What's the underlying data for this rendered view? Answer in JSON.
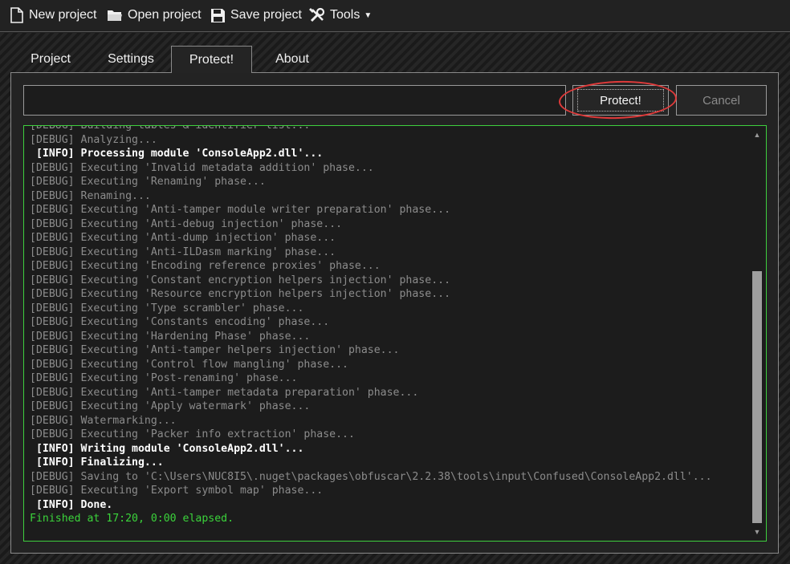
{
  "toolbar": {
    "new_project": "New project",
    "open_project": "Open project",
    "save_project": "Save project",
    "tools": "Tools"
  },
  "tabs": [
    "Project",
    "Settings",
    "Protect!",
    "About"
  ],
  "active_tab": "Protect!",
  "buttons": {
    "protect": "Protect!",
    "cancel": "Cancel"
  },
  "log": [
    {
      "level": "debug",
      "text": "[DEBUG] Building tables & identifier list..."
    },
    {
      "level": "debug",
      "text": "[DEBUG] Analyzing..."
    },
    {
      "level": "info",
      "text": " [INFO] Processing module 'ConsoleApp2.dll'..."
    },
    {
      "level": "debug",
      "text": "[DEBUG] Executing 'Invalid metadata addition' phase..."
    },
    {
      "level": "debug",
      "text": "[DEBUG] Executing 'Renaming' phase..."
    },
    {
      "level": "debug",
      "text": "[DEBUG] Renaming..."
    },
    {
      "level": "debug",
      "text": "[DEBUG] Executing 'Anti-tamper module writer preparation' phase..."
    },
    {
      "level": "debug",
      "text": "[DEBUG] Executing 'Anti-debug injection' phase..."
    },
    {
      "level": "debug",
      "text": "[DEBUG] Executing 'Anti-dump injection' phase..."
    },
    {
      "level": "debug",
      "text": "[DEBUG] Executing 'Anti-ILDasm marking' phase..."
    },
    {
      "level": "debug",
      "text": "[DEBUG] Executing 'Encoding reference proxies' phase..."
    },
    {
      "level": "debug",
      "text": "[DEBUG] Executing 'Constant encryption helpers injection' phase..."
    },
    {
      "level": "debug",
      "text": "[DEBUG] Executing 'Resource encryption helpers injection' phase..."
    },
    {
      "level": "debug",
      "text": "[DEBUG] Executing 'Type scrambler' phase..."
    },
    {
      "level": "debug",
      "text": "[DEBUG] Executing 'Constants encoding' phase..."
    },
    {
      "level": "debug",
      "text": "[DEBUG] Executing 'Hardening Phase' phase..."
    },
    {
      "level": "debug",
      "text": "[DEBUG] Executing 'Anti-tamper helpers injection' phase..."
    },
    {
      "level": "debug",
      "text": "[DEBUG] Executing 'Control flow mangling' phase..."
    },
    {
      "level": "debug",
      "text": "[DEBUG] Executing 'Post-renaming' phase..."
    },
    {
      "level": "debug",
      "text": "[DEBUG] Executing 'Anti-tamper metadata preparation' phase..."
    },
    {
      "level": "debug",
      "text": "[DEBUG] Executing 'Apply watermark' phase..."
    },
    {
      "level": "debug",
      "text": "[DEBUG] Watermarking..."
    },
    {
      "level": "debug",
      "text": "[DEBUG] Executing 'Packer info extraction' phase..."
    },
    {
      "level": "info",
      "text": " [INFO] Writing module 'ConsoleApp2.dll'..."
    },
    {
      "level": "info",
      "text": " [INFO] Finalizing..."
    },
    {
      "level": "debug",
      "text": "[DEBUG] Saving to 'C:\\Users\\NUC8I5\\.nuget\\packages\\obfuscar\\2.2.38\\tools\\input\\Confused\\ConsoleApp2.dll'..."
    },
    {
      "level": "debug",
      "text": "[DEBUG] Executing 'Export symbol map' phase..."
    },
    {
      "level": "info",
      "text": " [INFO] Done."
    },
    {
      "level": "finished",
      "text": "Finished at 17:20, 0:00 elapsed."
    }
  ],
  "colors": {
    "log_border": "#3ecf3e",
    "finished_text": "#3bd43b",
    "callout": "#e03a3a"
  }
}
